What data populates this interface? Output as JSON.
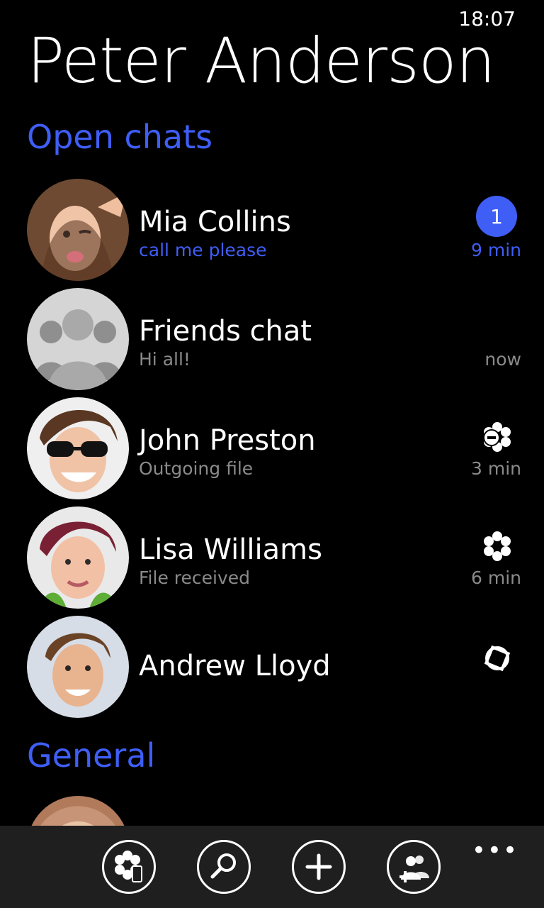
{
  "status": {
    "time": "18:07"
  },
  "header": {
    "title": "Peter Anderson"
  },
  "sections": {
    "open_chats": "Open chats",
    "general": "General"
  },
  "chats": [
    {
      "name": "Mia Collins",
      "subtitle": "call me please",
      "time": "9 min",
      "badge": "1",
      "status_icon": "unread-badge",
      "avatar": "mia-collins-avatar"
    },
    {
      "name": "Friends chat",
      "subtitle": "Hi all!",
      "time": "now",
      "status_icon": "",
      "avatar": "group-avatar"
    },
    {
      "name": "John Preston",
      "subtitle": "Outgoing file",
      "time": "3 min",
      "status_icon": "flower-minus-icon",
      "avatar": "john-preston-avatar"
    },
    {
      "name": "Lisa Williams",
      "subtitle": "File received",
      "time": "6 min",
      "status_icon": "flower-icon",
      "avatar": "lisa-williams-avatar"
    },
    {
      "name": "Andrew Lloyd",
      "subtitle": "",
      "time": "",
      "status_icon": "rotated-square-icon",
      "avatar": "andrew-lloyd-avatar"
    }
  ],
  "app_bar": {
    "buttons": [
      "flower-phone-icon",
      "search-icon",
      "add-icon",
      "add-group-icon"
    ],
    "more": "•••"
  },
  "colors": {
    "accent": "#3f5ef6",
    "background": "#000000",
    "appbar": "#1f1f1f"
  }
}
